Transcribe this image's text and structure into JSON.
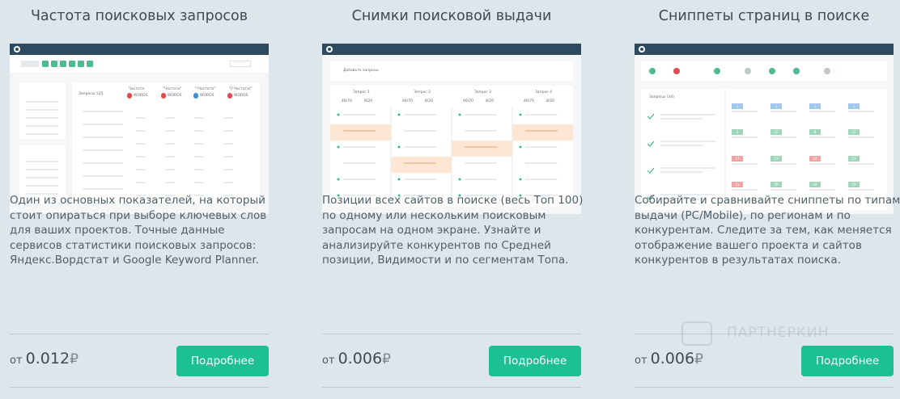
{
  "cards": [
    {
      "title": "Частота поисковых запросов",
      "description": [
        "Один из основных показателей, на который",
        "стоит опираться при выборе ключевых слов",
        "для ваших проектов. Точные данные",
        "сервисов статистики поисковых запросов:",
        "Яндекс.Вордстат и Google Keyword Planner."
      ],
      "price_prefix": "от",
      "price_value": "0.012",
      "currency": "₽",
      "button": "Подробнее"
    },
    {
      "title": "Снимки поисковой выдачи",
      "description": [
        "Позиции всех сайтов в поиске (весь Топ 100)",
        "по одному или нескольким поисковым",
        "запросам на одном экране. Узнайте и",
        "анализируйте конкурентов по Средней",
        "позиции, Видимости и по сегментам Топа."
      ],
      "price_prefix": "от",
      "price_value": "0.006",
      "currency": "₽",
      "button": "Подробнее"
    },
    {
      "title": "Сниппеты страниц в поиске",
      "description": [
        "Собирайте и сравнивайте сниппеты по типам",
        "выдачи (PC/Mobile), по регионам и по",
        "конкурентам. Следите за тем, как меняется",
        "отображение вашего проекта и сайтов",
        "конкурентов в результатах поиска."
      ],
      "price_prefix": "от",
      "price_value": "0.006",
      "currency": "₽",
      "button": "Подробнее"
    }
  ],
  "mockup1": {
    "col_head": "Запросы 125",
    "cols": [
      "Частота",
      "\"Частота\"",
      "\"!Частота\"",
      "\"[!Частота]\""
    ],
    "badge": "WORDS"
  },
  "mockup2": {
    "add_label": "Добавьте запросы",
    "cols": [
      "Запрос 1",
      "Запрос 2",
      "Запрос 3",
      "Запрос 4"
    ],
    "stats_a": "46/70",
    "stats_b": "8/20"
  },
  "mockup3": {
    "head": "Запросы (34)",
    "badges": [
      "1",
      "1",
      "1",
      "1",
      "2",
      "10",
      "8",
      "10",
      "17",
      "13",
      "24",
      "22",
      "21",
      "40",
      "44",
      "41"
    ]
  },
  "watermark": "ПАРТНЕРКИН",
  "colors": {
    "accent": "#1dbf94",
    "topbar": "#2d4a5e",
    "orange": "#f0a56a"
  }
}
